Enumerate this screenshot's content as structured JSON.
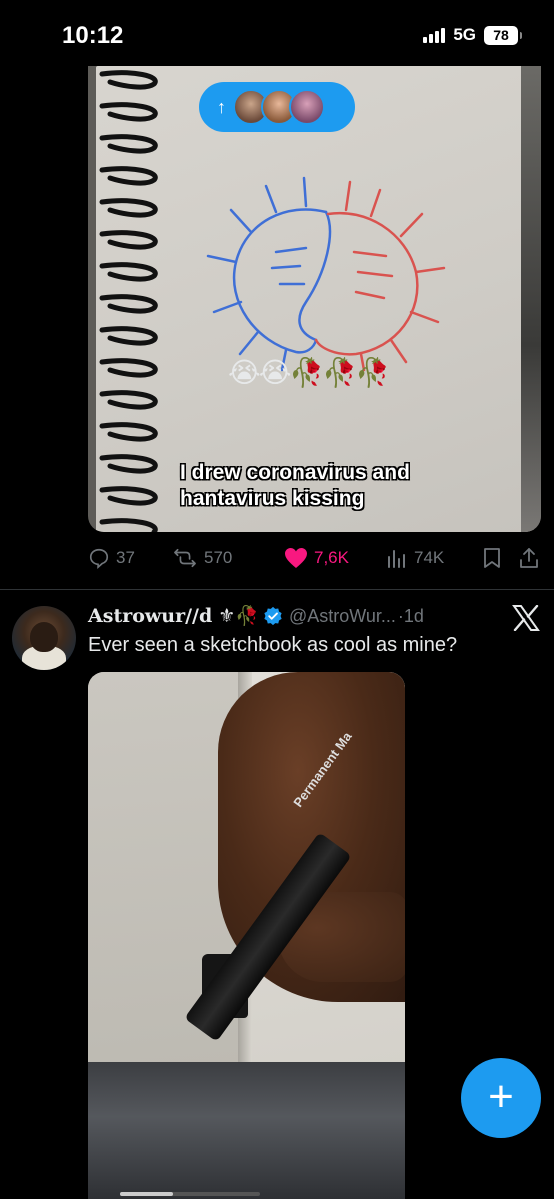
{
  "status_bar": {
    "time": "10:12",
    "network": "5G",
    "battery": "78"
  },
  "post1": {
    "caption_line1": "I drew coronavirus and",
    "caption_line2": "hantavirus kissing",
    "emoji_overlay": "😭😭🥀🥀🥀",
    "pill_arrow": "↑",
    "actions": {
      "replies": "37",
      "reposts": "570",
      "likes": "7,6K",
      "views": "74K"
    }
  },
  "post2": {
    "display_name": "Astrowur//d",
    "name_emoji": "⚜🥀",
    "handle": "@AstroWur...",
    "separator": "·",
    "time": "1d",
    "text": "Ever seen a  sketchbook as cool as mine?",
    "marker_text": "Permanent Ma",
    "video_progress": 0.38
  },
  "fab": {
    "label": "+"
  },
  "colors": {
    "accent": "#1d9bf0",
    "like": "#f91880",
    "muted": "#71767b",
    "background": "#000000"
  }
}
